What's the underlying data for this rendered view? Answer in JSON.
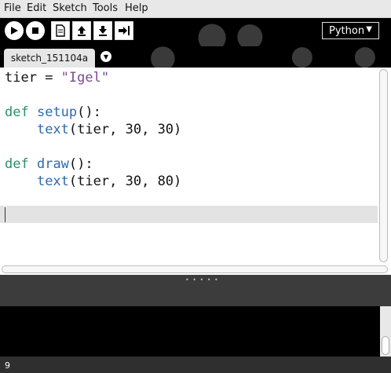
{
  "menu": [
    "File",
    "Edit",
    "Sketch",
    "Tools",
    "Help"
  ],
  "toolbar": {
    "run": "play-icon",
    "stop": "stop-icon",
    "new": "new-file-icon",
    "open": "upload-icon",
    "save": "download-icon",
    "export": "export-icon",
    "mode": "Python"
  },
  "tabs": [
    {
      "label": "sketch_151104a"
    }
  ],
  "editor": {
    "lines": [
      {
        "text": "tier = \"Igel\""
      },
      {
        "text": ""
      },
      {
        "text": "def setup():"
      },
      {
        "text": "    text(tier, 30, 30)"
      },
      {
        "text": ""
      },
      {
        "text": "def draw():"
      },
      {
        "text": "    text(tier, 30, 80)"
      },
      {
        "text": ""
      },
      {
        "text": ""
      }
    ]
  },
  "status": {
    "line_number": "9"
  },
  "colors": {
    "keyword": "#2b8f6f",
    "function": "#2d6ab0",
    "string": "#7b4b8f",
    "toolbar_bg": "#000000"
  }
}
